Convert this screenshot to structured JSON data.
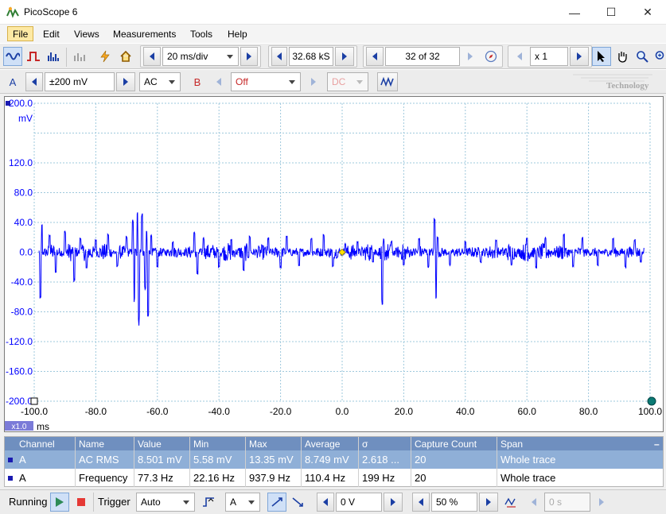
{
  "window": {
    "title": "PicoScope 6",
    "minimize": "—",
    "maximize": "☐",
    "close": "✕"
  },
  "menu": [
    "File",
    "Edit",
    "Views",
    "Measurements",
    "Tools",
    "Help"
  ],
  "toolbar1": {
    "timebase": "20 ms/div",
    "samples": "32.68 kS",
    "buffer": "32 of 32",
    "zoom": "x 1"
  },
  "toolbar2": {
    "channel_a": "A",
    "range_a": "±200 mV",
    "coupling_a": "AC",
    "channel_b": "B",
    "range_b": "Off",
    "coupling_b": "DC"
  },
  "watermark": "Technology",
  "scope": {
    "y_unit": "mV",
    "y_ticks": [
      "200.0",
      "120.0",
      "80.0",
      "40.0",
      "0.0",
      "-40.0",
      "-80.0",
      "-120.0",
      "-160.0",
      "-200.0"
    ],
    "x_ticks": [
      "-100.0",
      "-80.0",
      "-60.0",
      "-40.0",
      "-20.0",
      "0.0",
      "20.0",
      "40.0",
      "60.0",
      "80.0",
      "100.0"
    ],
    "x_unit": "ms",
    "x_scale": "x1.0",
    "trace_color": "#0000ff"
  },
  "chart_data": {
    "type": "line",
    "xlabel": "ms",
    "ylabel": "mV",
    "xlim": [
      -100,
      100
    ],
    "ylim": [
      -200,
      200
    ],
    "grid": true,
    "series": [
      {
        "spikes": [
          {
            "x": -98,
            "y": -62
          },
          {
            "x": -97.5,
            "y": 38
          },
          {
            "x": -95,
            "y": 25
          },
          {
            "x": -93,
            "y": -28
          },
          {
            "x": -90,
            "y": 30
          },
          {
            "x": -87,
            "y": -40
          },
          {
            "x": -85,
            "y": 20
          },
          {
            "x": -83,
            "y": -22
          },
          {
            "x": -80,
            "y": 18
          },
          {
            "x": -76,
            "y": 25
          },
          {
            "x": -73,
            "y": -20
          },
          {
            "x": -70,
            "y": 22
          },
          {
            "x": -68,
            "y": 45
          },
          {
            "x": -67.5,
            "y": -70
          },
          {
            "x": -66.5,
            "y": 58
          },
          {
            "x": -66,
            "y": -100
          },
          {
            "x": -65,
            "y": 55
          },
          {
            "x": -64,
            "y": -50
          },
          {
            "x": -63.5,
            "y": 30
          },
          {
            "x": -63,
            "y": -90
          },
          {
            "x": -62,
            "y": 25
          },
          {
            "x": -60,
            "y": -20
          },
          {
            "x": -55,
            "y": 15
          },
          {
            "x": -48,
            "y": 28
          },
          {
            "x": -47,
            "y": -30
          },
          {
            "x": -45,
            "y": 20
          },
          {
            "x": -40,
            "y": -22
          },
          {
            "x": -36,
            "y": 18
          },
          {
            "x": -32,
            "y": -25
          },
          {
            "x": -30,
            "y": 22
          },
          {
            "x": -24,
            "y": 20
          },
          {
            "x": -20,
            "y": -22
          },
          {
            "x": -18,
            "y": 24
          },
          {
            "x": -14,
            "y": -18
          },
          {
            "x": -10,
            "y": 20
          },
          {
            "x": -6,
            "y": 25
          },
          {
            "x": -3,
            "y": -20
          },
          {
            "x": 1,
            "y": 12
          },
          {
            "x": 5,
            "y": 15
          },
          {
            "x": 10,
            "y": -15
          },
          {
            "x": 13,
            "y": -70
          },
          {
            "x": 13.5,
            "y": 18
          },
          {
            "x": 16,
            "y": 15
          },
          {
            "x": 20,
            "y": -18
          },
          {
            "x": 25,
            "y": 20
          },
          {
            "x": 28,
            "y": -22
          },
          {
            "x": 30,
            "y": 48
          },
          {
            "x": 30.5,
            "y": -70
          },
          {
            "x": 31,
            "y": 22
          },
          {
            "x": 35,
            "y": -18
          },
          {
            "x": 40,
            "y": 15
          },
          {
            "x": 45,
            "y": -15
          },
          {
            "x": 50,
            "y": 18
          },
          {
            "x": 55,
            "y": -18
          },
          {
            "x": 60,
            "y": 20
          },
          {
            "x": 63,
            "y": -22
          },
          {
            "x": 66,
            "y": 20
          },
          {
            "x": 72,
            "y": 25
          },
          {
            "x": 75,
            "y": -20
          },
          {
            "x": 78,
            "y": 20
          },
          {
            "x": 83,
            "y": -18
          },
          {
            "x": 88,
            "y": 20
          },
          {
            "x": 92,
            "y": -22
          },
          {
            "x": 95,
            "y": 18
          },
          {
            "x": 97,
            "y": -14
          }
        ],
        "noise_amplitude_mv": 8
      }
    ]
  },
  "measurements": {
    "columns": [
      "Channel",
      "Name",
      "Value",
      "Min",
      "Max",
      "Average",
      "σ",
      "Capture Count",
      "Span"
    ],
    "rows": [
      [
        "A",
        "AC RMS",
        "8.501 mV",
        "5.58 mV",
        "13.35 mV",
        "8.749 mV",
        "2.618 ...",
        "20",
        "Whole trace"
      ],
      [
        "A",
        "Frequency",
        "77.3 Hz",
        "22.16 Hz",
        "937.9 Hz",
        "110.4 Hz",
        "199 Hz",
        "20",
        "Whole trace"
      ]
    ],
    "close_glyph": "–"
  },
  "statusbar": {
    "running": "Running",
    "trigger": "Trigger",
    "mode": "Auto",
    "source": "A",
    "threshold": "0 V",
    "pretrigger": "50 %",
    "delay": "0 s"
  }
}
